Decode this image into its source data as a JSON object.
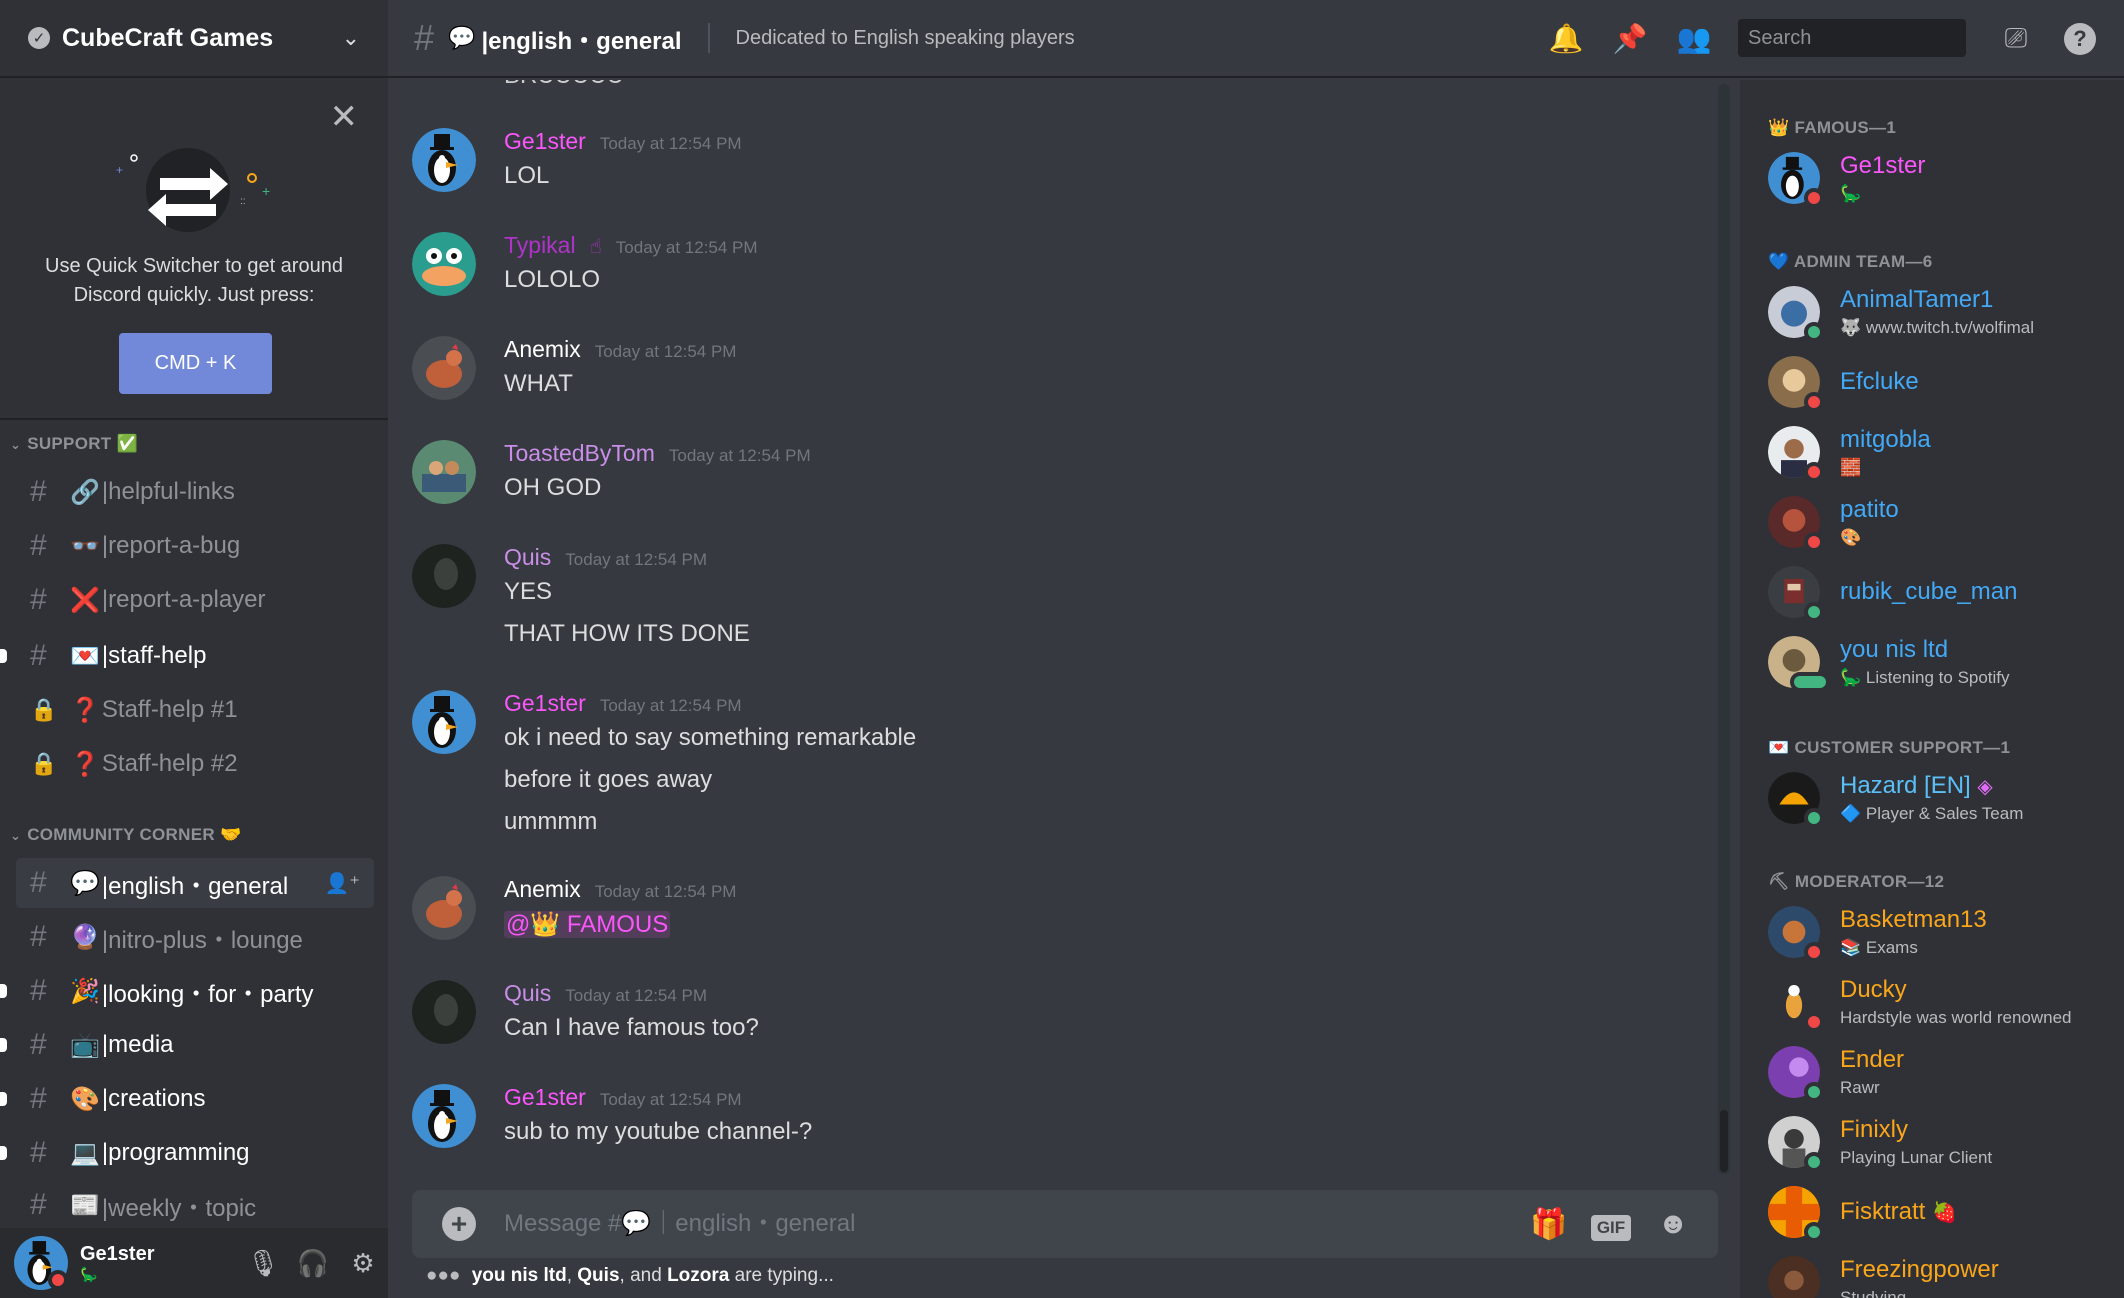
{
  "guild": {
    "name": "CubeCraft Games"
  },
  "quick_switcher": {
    "text_line1": "Use Quick Switcher to get around",
    "text_line2": "Discord quickly. Just press:",
    "button": "CMD + K"
  },
  "sidebar": {
    "cat_support": "SUPPORT",
    "cat_support_emoji": "✅",
    "cat_community": "COMMUNITY CORNER",
    "cat_community_emoji": "🤝",
    "channels": [
      {
        "emoji": "🔗",
        "label": "|helpful-links"
      },
      {
        "emoji": "👓",
        "label": "|report-a-bug"
      },
      {
        "emoji": "❌",
        "label": "|report-a-player"
      },
      {
        "emoji": "💌",
        "label": "|staff-help"
      },
      {
        "emoji": "❓",
        "label": "Staff-help #1"
      },
      {
        "emoji": "❓",
        "label": "Staff-help #2"
      },
      {
        "emoji": "💬",
        "label": "|english・general"
      },
      {
        "emoji": "🔮",
        "label": "|nitro-plus・lounge"
      },
      {
        "emoji": "🎉",
        "label": "|looking・for・party"
      },
      {
        "emoji": "📺",
        "label": "|media"
      },
      {
        "emoji": "🎨",
        "label": "|creations"
      },
      {
        "emoji": "💻",
        "label": "|programming"
      },
      {
        "emoji": "📰",
        "label": "|weekly・topic"
      }
    ]
  },
  "user_panel": {
    "username": "Ge1ster",
    "status_emoji": "🦕"
  },
  "header": {
    "channel_emoji": "💬",
    "channel_name": "|english・general",
    "topic": "Dedicated to English speaking players",
    "search_placeholder": "Search"
  },
  "messages": [
    {
      "author": "Ge1ster",
      "color": "#fa56fa",
      "time": "Today at 12:54 PM",
      "lines": [
        "LOL"
      ]
    },
    {
      "author": "Typikal",
      "color": "#b033c9",
      "time": "Today at 12:54 PM",
      "lines": [
        "LOLOLO"
      ]
    },
    {
      "author": "Anemix",
      "color": "#ffffff",
      "time": "Today at 12:54 PM",
      "lines": [
        "WHAT"
      ]
    },
    {
      "author": "ToastedByTom",
      "color": "#c98ee8",
      "time": "Today at 12:54 PM",
      "lines": [
        "OH GOD"
      ]
    },
    {
      "author": "Quis",
      "color": "#c98ee8",
      "time": "Today at 12:54 PM",
      "lines": [
        "YES",
        "THAT HOW ITS DONE"
      ]
    },
    {
      "author": "Ge1ster",
      "color": "#fa56fa",
      "time": "Today at 12:54 PM",
      "lines": [
        "ok i need to say something remarkable",
        "before it goes away",
        "ummmm"
      ]
    },
    {
      "author": "Anemix",
      "color": "#ffffff",
      "time": "Today at 12:54 PM",
      "mention": "@👑 FAMOUS"
    },
    {
      "author": "Quis",
      "color": "#c98ee8",
      "time": "Today at 12:54 PM",
      "lines": [
        "Can I have famous too?"
      ]
    },
    {
      "author": "Ge1ster",
      "color": "#fa56fa",
      "time": "Today at 12:54 PM",
      "lines": [
        "sub to my youtube channel-?"
      ]
    }
  ],
  "partial_top_message": "BRUUUUU",
  "composer": {
    "placeholder": "Message #💬｜english・general",
    "gif": "GIF"
  },
  "typing": {
    "users": [
      "you nis ltd",
      "Quis",
      "Lozora"
    ],
    "sep1": ", ",
    "sep2": ", and ",
    "suffix": " are typing..."
  },
  "members": {
    "roles": [
      {
        "label": "FAMOUS—1",
        "emoji": "👑"
      },
      {
        "label": "ADMIN TEAM—6",
        "emoji": "💙"
      },
      {
        "label": "CUSTOMER SUPPORT—1",
        "emoji": "💌"
      },
      {
        "label": "MODERATOR—12",
        "emoji": "⛏"
      }
    ],
    "list": [
      {
        "name": "Ge1ster",
        "color": "#fa56fa",
        "activity": "🦕",
        "status": "dnd"
      },
      {
        "name": "AnimalTamer1",
        "color": "#43a9f5",
        "activity": "🐺 www.twitch.tv/wolfimal",
        "status": "online"
      },
      {
        "name": "Efcluke",
        "color": "#43a9f5",
        "activity": "",
        "status": "dnd"
      },
      {
        "name": "mitgobla",
        "color": "#43a9f5",
        "activity": "🧱",
        "status": "dnd"
      },
      {
        "name": "patito",
        "color": "#43a9f5",
        "activity": "🎨",
        "status": "dnd"
      },
      {
        "name": "rubik_cube_man",
        "color": "#43a9f5",
        "activity": "",
        "status": "online"
      },
      {
        "name": "you nis ltd",
        "color": "#43a9f5",
        "activity": "🦕 Listening to Spotify",
        "status": "online"
      },
      {
        "name": "Hazard [EN]",
        "color": "#5bc0f8",
        "activity": "🔷 Player & Sales Team",
        "status": "online"
      },
      {
        "name": "Basketman13",
        "color": "#faa61a",
        "activity": "📚 Exams",
        "status": "dnd"
      },
      {
        "name": "Ducky",
        "color": "#faa61a",
        "activity": "Hardstyle was world renowned",
        "status": "dnd"
      },
      {
        "name": "Ender",
        "color": "#faa61a",
        "activity": "Rawr",
        "status": "online"
      },
      {
        "name": "Finixly",
        "color": "#faa61a",
        "activity": "Playing Lunar Client",
        "status": "online"
      },
      {
        "name": "Fisktratt",
        "color": "#faa61a",
        "activity": "",
        "status": "online"
      },
      {
        "name": "Freezingpower",
        "color": "#faa61a",
        "activity": "Studying",
        "status": "online"
      }
    ]
  }
}
